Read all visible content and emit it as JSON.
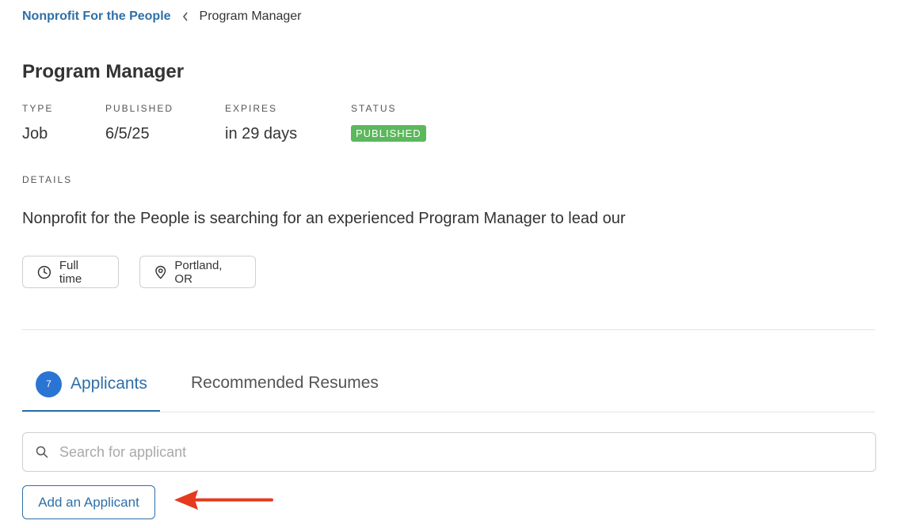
{
  "breadcrumb": {
    "org_link": "Nonprofit For the People",
    "current": "Program Manager"
  },
  "job": {
    "title": "Program Manager",
    "meta": {
      "type_label": "TYPE",
      "type_value": "Job",
      "published_label": "PUBLISHED",
      "published_value": "6/5/25",
      "expires_label": "EXPIRES",
      "expires_value": "in 29 days",
      "status_label": "STATUS",
      "status_value": "PUBLISHED"
    },
    "details_label": "DETAILS",
    "details_text": "Nonprofit for the People is searching for an experienced Program Manager to lead our",
    "tags": {
      "employment": "Full time",
      "location": "Portland, OR"
    }
  },
  "tabs": {
    "applicants_count": "7",
    "applicants_label": "Applicants",
    "resumes_label": "Recommended Resumes"
  },
  "search": {
    "placeholder": "Search for applicant",
    "value": ""
  },
  "actions": {
    "add_applicant_label": "Add an Applicant"
  },
  "colors": {
    "link": "#2f6fa8",
    "status_green": "#5cb85c",
    "badge_blue": "#2a74d3",
    "annotation_red": "#e53a1e"
  }
}
